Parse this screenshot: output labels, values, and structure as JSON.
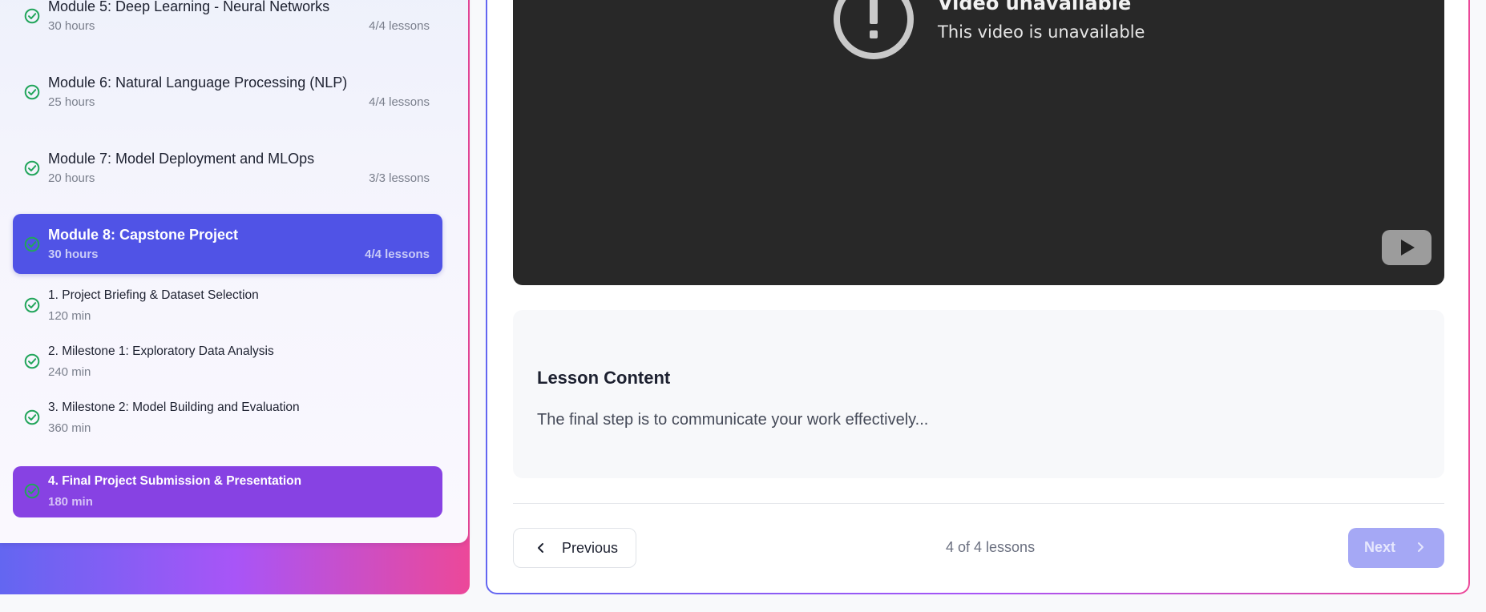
{
  "sidebar": {
    "modules": [
      {
        "title": "Module 5: Deep Learning - Neural Networks",
        "hours": "30 hours",
        "lessons": "4/4 lessons"
      },
      {
        "title": "Module 6: Natural Language Processing (NLP)",
        "hours": "25 hours",
        "lessons": "4/4 lessons"
      },
      {
        "title": "Module 7: Model Deployment and MLOps",
        "hours": "20 hours",
        "lessons": "3/3 lessons"
      },
      {
        "title": "Module 8: Capstone Project",
        "hours": "30 hours",
        "lessons": "4/4 lessons"
      }
    ],
    "lessons": [
      {
        "title": "1. Project Briefing & Dataset Selection",
        "duration": "120 min"
      },
      {
        "title": "2. Milestone 1: Exploratory Data Analysis",
        "duration": "240 min"
      },
      {
        "title": "3. Milestone 2: Model Building and Evaluation",
        "duration": "360 min"
      },
      {
        "title": "4. Final Project Submission & Presentation",
        "duration": "180 min"
      }
    ]
  },
  "video": {
    "title": "Video unavailable",
    "subtitle": "This video is unavailable"
  },
  "content": {
    "heading": "Lesson Content",
    "body": "The final step is to communicate your work effectively..."
  },
  "nav": {
    "previous_label": "Previous",
    "progress": "4 of 4 lessons",
    "next_label": "Next"
  },
  "colors": {
    "accent": "#5053e6",
    "active_lesson": "#8742e3",
    "check": "#22a55b",
    "next_disabled": "#a5a8f5"
  }
}
